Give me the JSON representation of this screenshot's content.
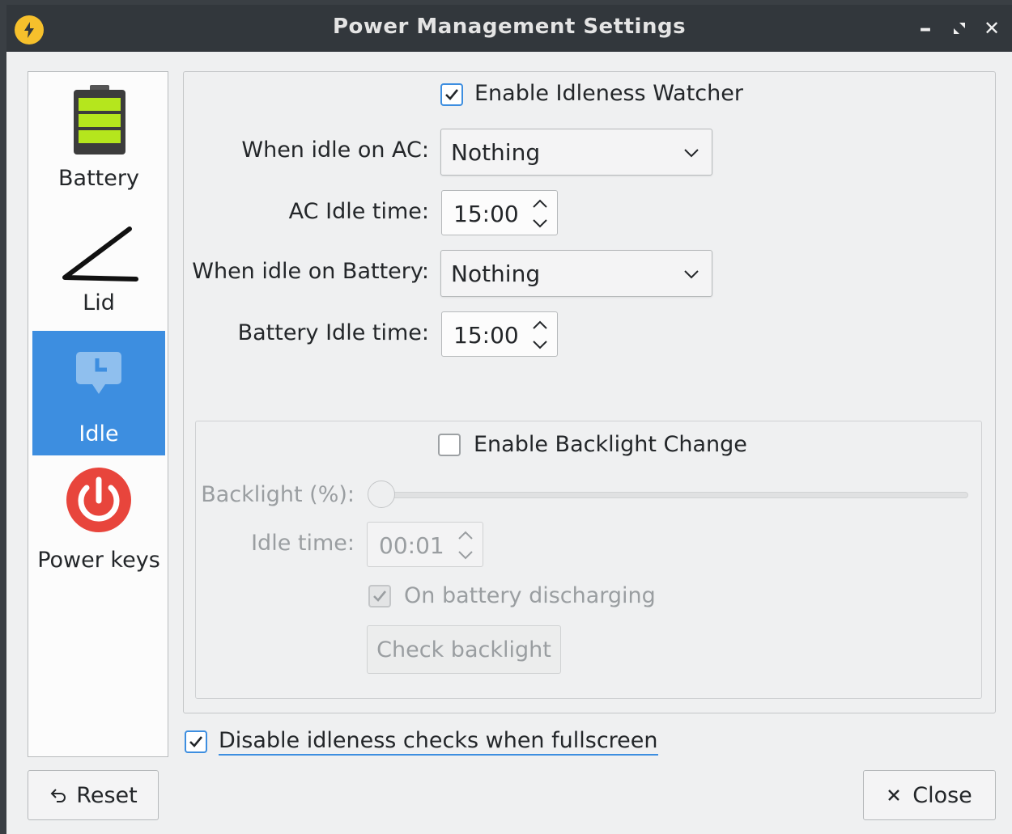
{
  "window": {
    "title": "Power Management Settings",
    "minimize_symbol": "–",
    "close_symbol": "✕"
  },
  "sidebar": {
    "items": [
      {
        "label": "Battery",
        "icon": "battery-icon"
      },
      {
        "label": "Lid",
        "icon": "lid-icon"
      },
      {
        "label": "Idle",
        "icon": "idle-icon",
        "active": true
      },
      {
        "label": "Power keys",
        "icon": "power-icon"
      }
    ]
  },
  "idle": {
    "enable_watcher_label": "Enable Idleness Watcher",
    "enable_watcher_checked": true,
    "ac_action_label": "When idle on AC:",
    "ac_action_value": "Nothing",
    "ac_time_label": "AC Idle time:",
    "ac_time_value": "15:00",
    "battery_action_label": "When idle on Battery:",
    "battery_action_value": "Nothing",
    "battery_time_label": "Battery Idle time:",
    "battery_time_value": "15:00"
  },
  "backlight": {
    "enable_label": "Enable Backlight Change",
    "enable_checked": false,
    "percent_label": "Backlight (%):",
    "percent_value": 0,
    "idle_time_label": "Idle time:",
    "idle_time_value": "00:01",
    "on_battery_label": "On battery discharging",
    "on_battery_checked": true,
    "check_button_label": "Check backlight"
  },
  "fullscreen": {
    "label": "Disable idleness checks when fullscreen",
    "checked": true
  },
  "footer": {
    "reset_label": "Reset",
    "close_label": "Close"
  },
  "colors": {
    "accent": "#3d8ee0",
    "titlebar": "#32373c",
    "battery_green": "#b5e61d",
    "power_red": "#e8453c"
  }
}
